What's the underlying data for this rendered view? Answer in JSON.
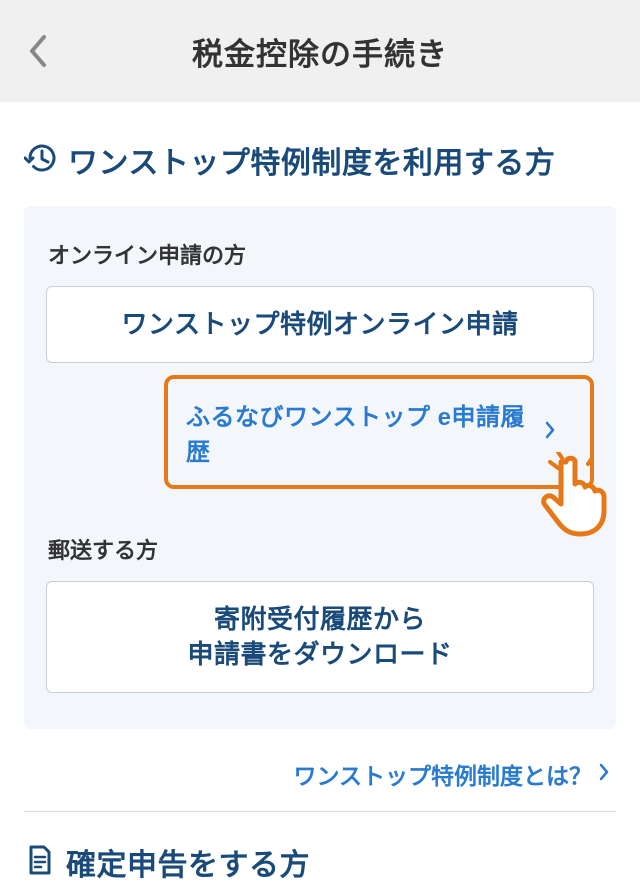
{
  "header": {
    "title": "税金控除の手続き"
  },
  "section1": {
    "heading": "ワンストップ特例制度を利用する方",
    "online_label": "オンライン申請の方",
    "online_button": "ワンストップ特例オンライン申請",
    "history_link": "ふるなびワンストップ e申請履歴",
    "mail_label": "郵送する方",
    "mail_button": "寄附受付履歴から\n申請書をダウンロード",
    "info_link": "ワンストップ特例制度とは？"
  },
  "section2": {
    "heading": "確定申告をする方"
  }
}
